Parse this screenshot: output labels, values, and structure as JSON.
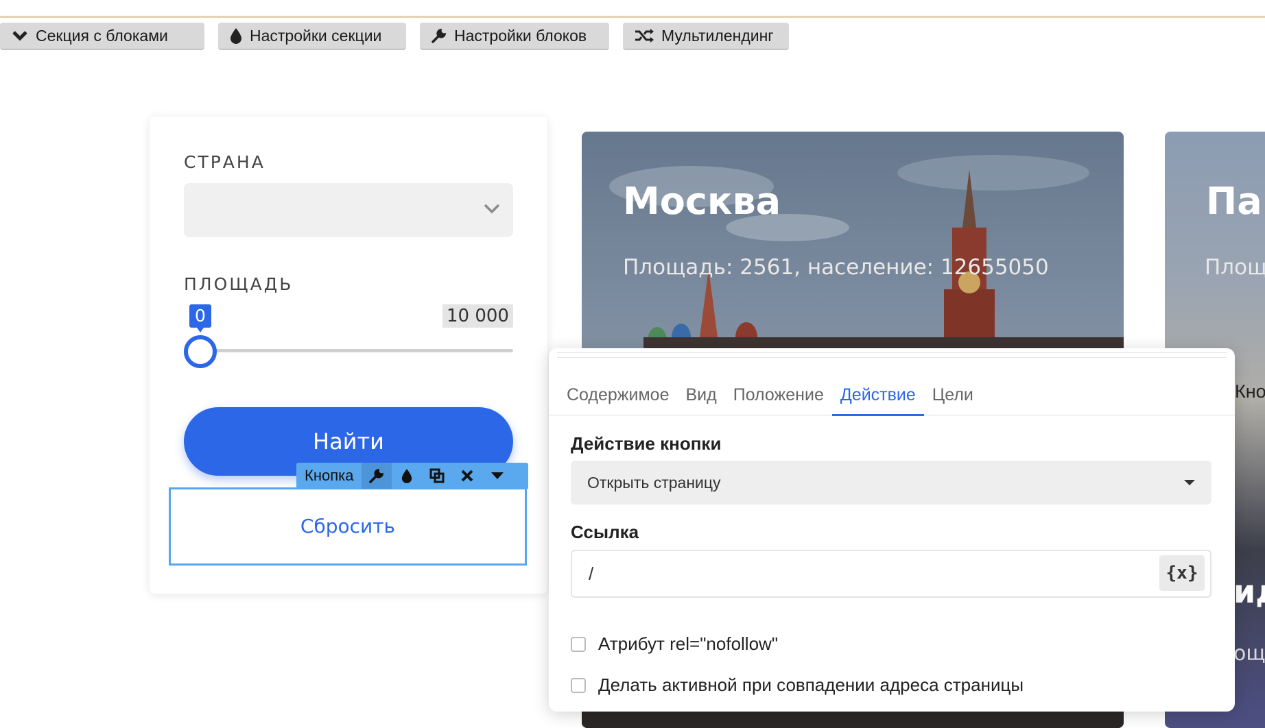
{
  "toolbar": {
    "section_blocks": "Секция с блоками",
    "section_settings": "Настройки секции",
    "block_settings": "Настройки блоков",
    "multilanding": "Мультилендинг"
  },
  "filter": {
    "country_label": "СТРАНА",
    "country_value": "",
    "area_label": "ПЛОЩАДЬ",
    "range_min": "0",
    "range_max": "10 000",
    "find_button": "Найти",
    "reset_button": "Сбросить"
  },
  "element_toolbar": {
    "label": "Кнопка"
  },
  "cities": [
    {
      "title": "Москва",
      "subtitle": "Площадь: 2561, население: 12655050"
    },
    {
      "title": "Пар",
      "subtitle": "Площ"
    }
  ],
  "partial": {
    "kn": "Кно",
    "id": "ид",
    "od": "ощ"
  },
  "panel": {
    "tabs": [
      "Содержимое",
      "Вид",
      "Положение",
      "Действие",
      "Цели"
    ],
    "active_tab": "Действие",
    "action_label": "Действие кнопки",
    "action_value": "Открыть страницу",
    "link_label": "Ссылка",
    "link_value": "/",
    "var_button": "{x}",
    "checkbox_nofollow": "Атрибут rel=\"nofollow\"",
    "checkbox_active": "Делать активной при совпадении адреса страницы"
  },
  "colors": {
    "accent": "#2c67e8",
    "selection": "#58a6f0",
    "toolbar_bg": "#d9d9d9"
  }
}
